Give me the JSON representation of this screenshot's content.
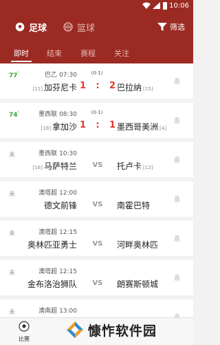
{
  "status_bar": {
    "time": "10:06",
    "icons": [
      "wifi-icon",
      "signal-icon",
      "battery-icon"
    ]
  },
  "header": {
    "sports": [
      {
        "label": "足球",
        "icon": "soccer-ball-icon",
        "active": true
      },
      {
        "label": "篮球",
        "icon": "basketball-icon",
        "active": false
      }
    ],
    "filter_label": "筛选"
  },
  "tabs": [
    {
      "label": "即时",
      "active": true
    },
    {
      "label": "结束",
      "active": false
    },
    {
      "label": "赛程",
      "active": false
    },
    {
      "label": "关注",
      "active": false
    }
  ],
  "matches": [
    {
      "status": "77",
      "live": true,
      "league": "巴乙",
      "time": "07:30",
      "half": "(0-1)",
      "home_rank": "[11]",
      "home": "加芬尼卡",
      "home_score": "1",
      "away_score": "2",
      "away": "巴拉纳",
      "away_rank": "[15]"
    },
    {
      "status": "74",
      "live": true,
      "league": "墨西联",
      "time": "08:30",
      "half": "(0-1)",
      "home_rank": "[18]",
      "home": "拿加沙",
      "home_score": "1",
      "away_score": "1",
      "away": "墨西哥美洲",
      "away_rank": "[4]"
    },
    {
      "status": "未",
      "live": false,
      "league": "墨西联",
      "time": "10:30",
      "half": "",
      "home_rank": "[16]",
      "home": "马萨特兰",
      "vs": "VS",
      "away": "托卢卡",
      "away_rank": "[12]"
    },
    {
      "status": "未",
      "live": false,
      "league": "澳塔超",
      "time": "12:00",
      "half": "",
      "home_rank": "",
      "home": "德文前锋",
      "vs": "VS",
      "away": "南霍巴特",
      "away_rank": ""
    },
    {
      "status": "未",
      "live": false,
      "league": "澳塔超",
      "time": "12:15",
      "half": "",
      "home_rank": "",
      "home": "奥林匹亚勇士",
      "vs": "VS",
      "away": "河畔奥林匹",
      "away_rank": ""
    },
    {
      "status": "未",
      "live": false,
      "league": "澳塔超",
      "time": "12:15",
      "half": "",
      "home_rank": "",
      "home": "金布洛治狮队",
      "vs": "VS",
      "away": "朗赛斯顿城",
      "away_rank": ""
    },
    {
      "status": "未",
      "live": false,
      "league": "澳南超",
      "time": "13:00",
      "half": "",
      "home_rank": "",
      "home": "",
      "vs": "",
      "away": "",
      "away_rank": ""
    }
  ],
  "bottom_nav": {
    "label": "比赛",
    "icon": "soccer-ball-icon"
  },
  "watermark": {
    "text": "慷怍软件园"
  },
  "colors": {
    "primary": "#9b2a22",
    "live": "#3aa635",
    "score": "#e23a2a"
  }
}
